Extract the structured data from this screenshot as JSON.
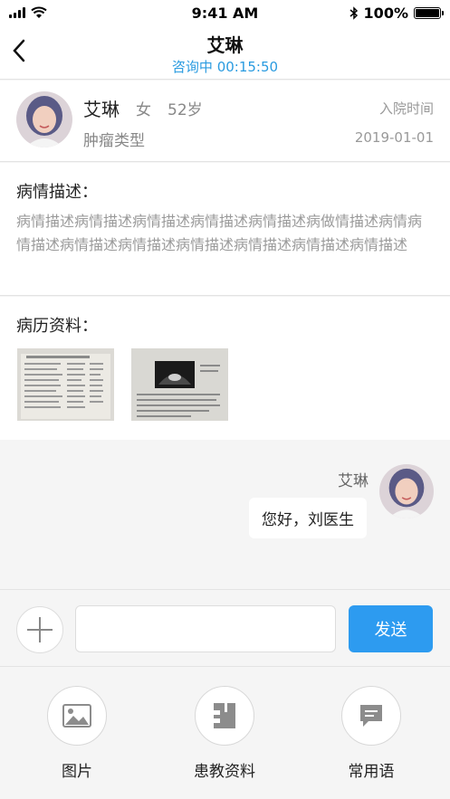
{
  "status_bar": {
    "time": "9:41 AM",
    "battery": "100%",
    "icons": [
      "signal-icon",
      "wifi-icon",
      "bluetooth-icon",
      "battery-icon"
    ]
  },
  "nav": {
    "title": "艾琳",
    "status": "咨询中 00:15:50",
    "back_icon": "chevron-left-icon"
  },
  "patient": {
    "name": "艾琳",
    "gender": "女",
    "age": "52岁",
    "tumor_type": "肿瘤类型",
    "admission_label": "入院时间",
    "admission_date": "2019-01-01"
  },
  "description": {
    "title": "病情描述：",
    "text": "病情描述病情描述病情描述病情描述病情描述病做情描述病情病情描述病情描述病情描述病情描述病情描述病情描述病情描述"
  },
  "records": {
    "title": "病历资料："
  },
  "chat": {
    "sender": "艾琳",
    "message": "您好，刘医生"
  },
  "input": {
    "placeholder": "",
    "send_label": "发送"
  },
  "tools": [
    {
      "label": "图片",
      "icon": "image-icon"
    },
    {
      "label": "患教资料",
      "icon": "document-icon"
    },
    {
      "label": "常用语",
      "icon": "message-icon"
    }
  ],
  "colors": {
    "accent": "#2d9bf0",
    "status_text": "#2a9be0"
  }
}
